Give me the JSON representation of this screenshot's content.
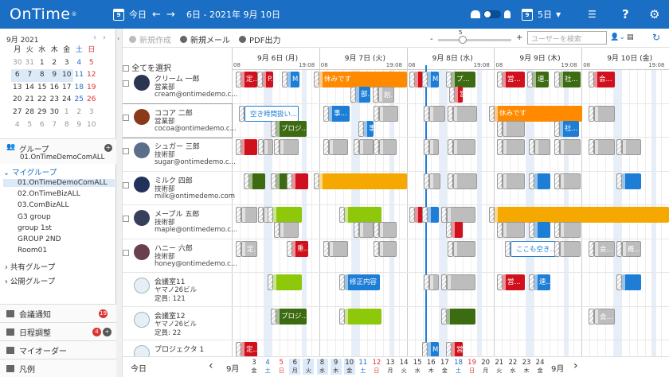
{
  "app": {
    "logo": "OnTime",
    "reg": "®"
  },
  "topbar": {
    "today": "今日",
    "cal_num": "9",
    "prev": "←",
    "next": "→",
    "range": "6日 - 2021年 9月 10日",
    "view_num": "9",
    "view": "5日",
    "help": "?"
  },
  "minical": {
    "title": "9月 2021",
    "prev": "‹",
    "next": "›",
    "weekdays": [
      "月",
      "火",
      "水",
      "木",
      "金",
      "土",
      "日"
    ],
    "weeks": [
      [
        "30",
        "31",
        "1",
        "2",
        "3",
        "4",
        "5"
      ],
      [
        "6",
        "7",
        "8",
        "9",
        "10",
        "11",
        "12"
      ],
      [
        "13",
        "14",
        "15",
        "16",
        "17",
        "18",
        "19"
      ],
      [
        "20",
        "21",
        "22",
        "23",
        "24",
        "25",
        "26"
      ],
      [
        "27",
        "28",
        "29",
        "30",
        "1",
        "2",
        "3"
      ],
      [
        "4",
        "5",
        "6",
        "7",
        "8",
        "9",
        "10"
      ]
    ]
  },
  "sidebar": {
    "groups_label": "グループ",
    "groups_sub": "01.OnTimeDemoComALL",
    "my_groups": "マイグループ",
    "items": [
      "01.OnTimeDemoComALL",
      "02.OnTimeBizALL",
      "03.ComBizALL",
      "G3 group",
      "group 1st",
      "GROUP 2ND",
      "Room01"
    ],
    "shared": "共有グループ",
    "public": "公開グループ",
    "footer": [
      {
        "label": "会議通知",
        "badge": "19"
      },
      {
        "label": "日程調整",
        "badge": "4"
      },
      {
        "label": "マイオーダー",
        "badge": ""
      },
      {
        "label": "凡例",
        "badge": ""
      }
    ]
  },
  "toolbar": {
    "new": "新規作成",
    "mail": "新規メール",
    "pdf": "PDF出力",
    "zoom_value": "5",
    "minus": "-",
    "plus": "+",
    "search_placeholder": "ユーザーを検索"
  },
  "grid": {
    "select_all": "全てを選択",
    "days": [
      "9月 6日 (月)",
      "9月 7日 (火)",
      "9月 8日 (水)",
      "9月 9日 (木)",
      "9月 10日 (金)"
    ],
    "hour_start": "08",
    "hour_end": "19:08",
    "resources": [
      {
        "name": "クリーム 一郎",
        "dept": "営業部",
        "mail": "cream@ontimedemo.c..."
      },
      {
        "name": "ココア 二郎",
        "dept": "営業部",
        "mail": "cocoa@ontimedemo.c..."
      },
      {
        "name": "シュガー 三郎",
        "dept": "技術部",
        "mail": "sugar@ontimedemo.c..."
      },
      {
        "name": "ミルク 四郎",
        "dept": "技術部",
        "mail": "milk@ontimedemo.com"
      },
      {
        "name": "メープル 五郎",
        "dept": "技術部",
        "mail": "maple@ontimedemo.c..."
      },
      {
        "name": "ハニー 六郎",
        "dept": "技術部",
        "mail": "honey@ontimedemo.c..."
      },
      {
        "name": "会議室11",
        "dept": "ヤマノ26ビル",
        "mail": "定員: 121"
      },
      {
        "name": "会議室12",
        "dept": "ヤマノ26ビル",
        "mail": "定員: 22"
      },
      {
        "name": "プロジェクタ 1",
        "dept": "",
        "mail": ""
      }
    ],
    "events": [
      {
        "r": 0,
        "l": 12,
        "w": 20,
        "c": "red",
        "t": "定..."
      },
      {
        "r": 0,
        "l": 39,
        "w": 13,
        "c": "red",
        "t": "P..."
      },
      {
        "r": 0,
        "l": 70,
        "w": 15,
        "c": "blu",
        "t": "M"
      },
      {
        "r": 0,
        "l": 110,
        "w": 110,
        "c": "org2",
        "t": "休みです"
      },
      {
        "r": 0,
        "l": 156,
        "w": 18,
        "c": "blu",
        "t": "部...",
        "y": 1
      },
      {
        "r": 0,
        "l": 184,
        "w": 20,
        "c": "gry",
        "t": "創...",
        "y": 1
      },
      {
        "r": 0,
        "l": 230,
        "w": 10,
        "c": "red",
        "t": ""
      },
      {
        "r": 0,
        "l": 246,
        "w": 14,
        "c": "blu",
        "t": "M"
      },
      {
        "r": 0,
        "l": 276,
        "w": 30,
        "c": "grn",
        "t": "プ..."
      },
      {
        "r": 0,
        "l": 280,
        "w": 10,
        "c": "red",
        "t": "営",
        "y": 1
      },
      {
        "r": 0,
        "l": 340,
        "w": 28,
        "c": "red",
        "t": "営..."
      },
      {
        "r": 0,
        "l": 378,
        "w": 20,
        "c": "grn",
        "t": "連..."
      },
      {
        "r": 0,
        "l": 412,
        "w": 26,
        "c": "grn",
        "t": "社..."
      },
      {
        "r": 0,
        "l": 455,
        "w": 26,
        "c": "red",
        "t": "会..."
      },
      {
        "r": 1,
        "l": 16,
        "w": 68,
        "c": "out",
        "t": "空き時間扱い..."
      },
      {
        "r": 1,
        "l": 56,
        "w": 38,
        "c": "grn",
        "t": "プロジ...",
        "y": 1
      },
      {
        "r": 1,
        "l": 122,
        "w": 26,
        "c": "blu",
        "t": "事..."
      },
      {
        "r": 1,
        "l": 166,
        "w": 12,
        "c": "blu",
        "t": "事",
        "y": 1
      },
      {
        "r": 1,
        "l": 185,
        "w": 24,
        "c": "gry",
        "t": ""
      },
      {
        "r": 1,
        "l": 248,
        "w": 20,
        "c": "gry",
        "t": ""
      },
      {
        "r": 1,
        "l": 278,
        "w": 30,
        "c": "gry",
        "t": ""
      },
      {
        "r": 1,
        "l": 330,
        "w": 110,
        "c": "org2",
        "t": "休みです"
      },
      {
        "r": 1,
        "l": 340,
        "w": 28,
        "c": "gry",
        "t": "",
        "y": 1
      },
      {
        "r": 1,
        "l": 412,
        "w": 24,
        "c": "blu",
        "t": "社...",
        "y": 1
      },
      {
        "r": 1,
        "l": 455,
        "w": 26,
        "c": "gry",
        "t": ""
      },
      {
        "r": 2,
        "l": 12,
        "w": 20,
        "c": "red",
        "t": ""
      },
      {
        "r": 2,
        "l": 40,
        "w": 12,
        "c": "gry",
        "t": ""
      },
      {
        "r": 2,
        "l": 60,
        "w": 24,
        "c": "gry",
        "t": ""
      },
      {
        "r": 2,
        "l": 122,
        "w": 24,
        "c": "gry",
        "t": ""
      },
      {
        "r": 2,
        "l": 160,
        "w": 18,
        "c": "gry",
        "t": ""
      },
      {
        "r": 2,
        "l": 185,
        "w": 22,
        "c": "gry",
        "t": ""
      },
      {
        "r": 2,
        "l": 248,
        "w": 12,
        "c": "gry",
        "t": ""
      },
      {
        "r": 2,
        "l": 278,
        "w": 28,
        "c": "gry",
        "t": ""
      },
      {
        "r": 2,
        "l": 340,
        "w": 28,
        "c": "gry",
        "t": ""
      },
      {
        "r": 2,
        "l": 380,
        "w": 20,
        "c": "gry",
        "t": ""
      },
      {
        "r": 2,
        "l": 412,
        "w": 26,
        "c": "gry",
        "t": ""
      },
      {
        "r": 2,
        "l": 455,
        "w": 26,
        "c": "gry",
        "t": ""
      },
      {
        "r": 2,
        "l": 490,
        "w": 24,
        "c": "gry",
        "t": ""
      },
      {
        "r": 3,
        "l": 22,
        "w": 20,
        "c": "grn",
        "t": ""
      },
      {
        "r": 3,
        "l": 56,
        "w": 20,
        "c": "grn",
        "t": ""
      },
      {
        "r": 3,
        "l": 76,
        "w": 20,
        "c": "red",
        "t": ""
      },
      {
        "r": 3,
        "l": 110,
        "w": 110,
        "c": "org",
        "t": ""
      },
      {
        "r": 3,
        "l": 248,
        "w": 14,
        "c": "gry",
        "t": ""
      },
      {
        "r": 3,
        "l": 278,
        "w": 30,
        "c": "gry",
        "t": ""
      },
      {
        "r": 3,
        "l": 340,
        "w": 28,
        "c": "gry",
        "t": ""
      },
      {
        "r": 3,
        "l": 380,
        "w": 20,
        "c": "blu",
        "t": ""
      },
      {
        "r": 3,
        "l": 412,
        "w": 26,
        "c": "gry",
        "t": ""
      },
      {
        "r": 3,
        "l": 490,
        "w": 24,
        "c": "blu",
        "t": ""
      },
      {
        "r": 4,
        "l": 12,
        "w": 20,
        "c": "gry",
        "t": ""
      },
      {
        "r": 4,
        "l": 40,
        "w": 12,
        "c": "gry",
        "t": ""
      },
      {
        "r": 4,
        "l": 52,
        "w": 36,
        "c": "lime",
        "t": ""
      },
      {
        "r": 4,
        "l": 60,
        "w": 24,
        "c": "gry",
        "t": "",
        "y": 1
      },
      {
        "r": 4,
        "l": 142,
        "w": 46,
        "c": "lime",
        "t": ""
      },
      {
        "r": 4,
        "l": 160,
        "w": 18,
        "c": "gry",
        "t": "",
        "y": 1
      },
      {
        "r": 4,
        "l": 185,
        "w": 22,
        "c": "gry",
        "t": "",
        "y": 1
      },
      {
        "r": 4,
        "l": 230,
        "w": 10,
        "c": "red",
        "t": ""
      },
      {
        "r": 4,
        "l": 246,
        "w": 14,
        "c": "blu",
        "t": ""
      },
      {
        "r": 4,
        "l": 270,
        "w": 36,
        "c": "gry",
        "t": ""
      },
      {
        "r": 4,
        "l": 276,
        "w": 14,
        "c": "red",
        "t": "",
        "y": 1
      },
      {
        "r": 4,
        "l": 330,
        "w": 219,
        "c": "org",
        "t": ""
      },
      {
        "r": 4,
        "l": 340,
        "w": 28,
        "c": "gry",
        "t": "",
        "y": 1
      },
      {
        "r": 4,
        "l": 380,
        "w": 20,
        "c": "blu",
        "t": "",
        "y": 1
      },
      {
        "r": 4,
        "l": 412,
        "w": 26,
        "c": "gry",
        "t": "",
        "y": 1
      },
      {
        "r": 5,
        "l": 12,
        "w": 20,
        "c": "gry",
        "t": "定..."
      },
      {
        "r": 5,
        "l": 76,
        "w": 20,
        "c": "red",
        "t": "重..."
      },
      {
        "r": 5,
        "l": 122,
        "w": 24,
        "c": "gry",
        "t": ""
      },
      {
        "r": 5,
        "l": 185,
        "w": 22,
        "c": "gry",
        "t": ""
      },
      {
        "r": 5,
        "l": 278,
        "w": 28,
        "c": "gry",
        "t": ""
      },
      {
        "r": 5,
        "l": 350,
        "w": 58,
        "c": "out",
        "t": "ここも空き..."
      },
      {
        "r": 5,
        "l": 412,
        "w": 26,
        "c": "gry",
        "t": ""
      },
      {
        "r": 5,
        "l": 455,
        "w": 26,
        "c": "gry",
        "t": "会..."
      },
      {
        "r": 5,
        "l": 490,
        "w": 24,
        "c": "gry",
        "t": "概..."
      },
      {
        "r": 6,
        "l": 52,
        "w": 36,
        "c": "lime",
        "t": ""
      },
      {
        "r": 6,
        "l": 142,
        "w": 44,
        "c": "blu",
        "t": "修正内容"
      },
      {
        "r": 6,
        "l": 248,
        "w": 12,
        "c": "gry",
        "t": ""
      },
      {
        "r": 6,
        "l": 270,
        "w": 36,
        "c": "gry",
        "t": ""
      },
      {
        "r": 6,
        "l": 340,
        "w": 28,
        "c": "red",
        "t": "営..."
      },
      {
        "r": 6,
        "l": 380,
        "w": 20,
        "c": "blu",
        "t": "連..."
      },
      {
        "r": 6,
        "l": 490,
        "w": 24,
        "c": "blu",
        "t": ""
      },
      {
        "r": 7,
        "l": 56,
        "w": 38,
        "c": "grn",
        "t": "プロジ..."
      },
      {
        "r": 7,
        "l": 142,
        "w": 46,
        "c": "lime",
        "t": ""
      },
      {
        "r": 7,
        "l": 270,
        "w": 36,
        "c": "grn",
        "t": ""
      },
      {
        "r": 7,
        "l": 455,
        "w": 26,
        "c": "gry",
        "t": "会..."
      },
      {
        "r": 8,
        "l": 12,
        "w": 20,
        "c": "red",
        "t": "定..."
      },
      {
        "r": 8,
        "l": 246,
        "w": 14,
        "c": "blu",
        "t": "M"
      },
      {
        "r": 8,
        "l": 276,
        "w": 14,
        "c": "red",
        "t": "営"
      }
    ]
  },
  "bottom": {
    "today": "今日",
    "prev": "‹",
    "next": "›",
    "month": "9月",
    "month2": "9月",
    "days": [
      [
        "3",
        "金"
      ],
      [
        "4",
        "土"
      ],
      [
        "5",
        "日"
      ],
      [
        "6",
        "月"
      ],
      [
        "7",
        "火"
      ],
      [
        "8",
        "水"
      ],
      [
        "9",
        "木"
      ],
      [
        "10",
        "金"
      ],
      [
        "11",
        "土"
      ],
      [
        "12",
        "日"
      ],
      [
        "13",
        "月"
      ],
      [
        "14",
        "火"
      ],
      [
        "15",
        "水"
      ],
      [
        "16",
        "木"
      ],
      [
        "17",
        "金"
      ],
      [
        "18",
        "土"
      ],
      [
        "19",
        "日"
      ],
      [
        "20",
        "月"
      ],
      [
        "21",
        "火"
      ],
      [
        "22",
        "水"
      ],
      [
        "23",
        "木"
      ],
      [
        "24",
        "金"
      ]
    ]
  },
  "colors": {
    "primary": "#1a6fc4",
    "red": "#d0101c",
    "green": "#3d6b12",
    "blue": "#1e7ed6",
    "orange": "#f5a800"
  }
}
